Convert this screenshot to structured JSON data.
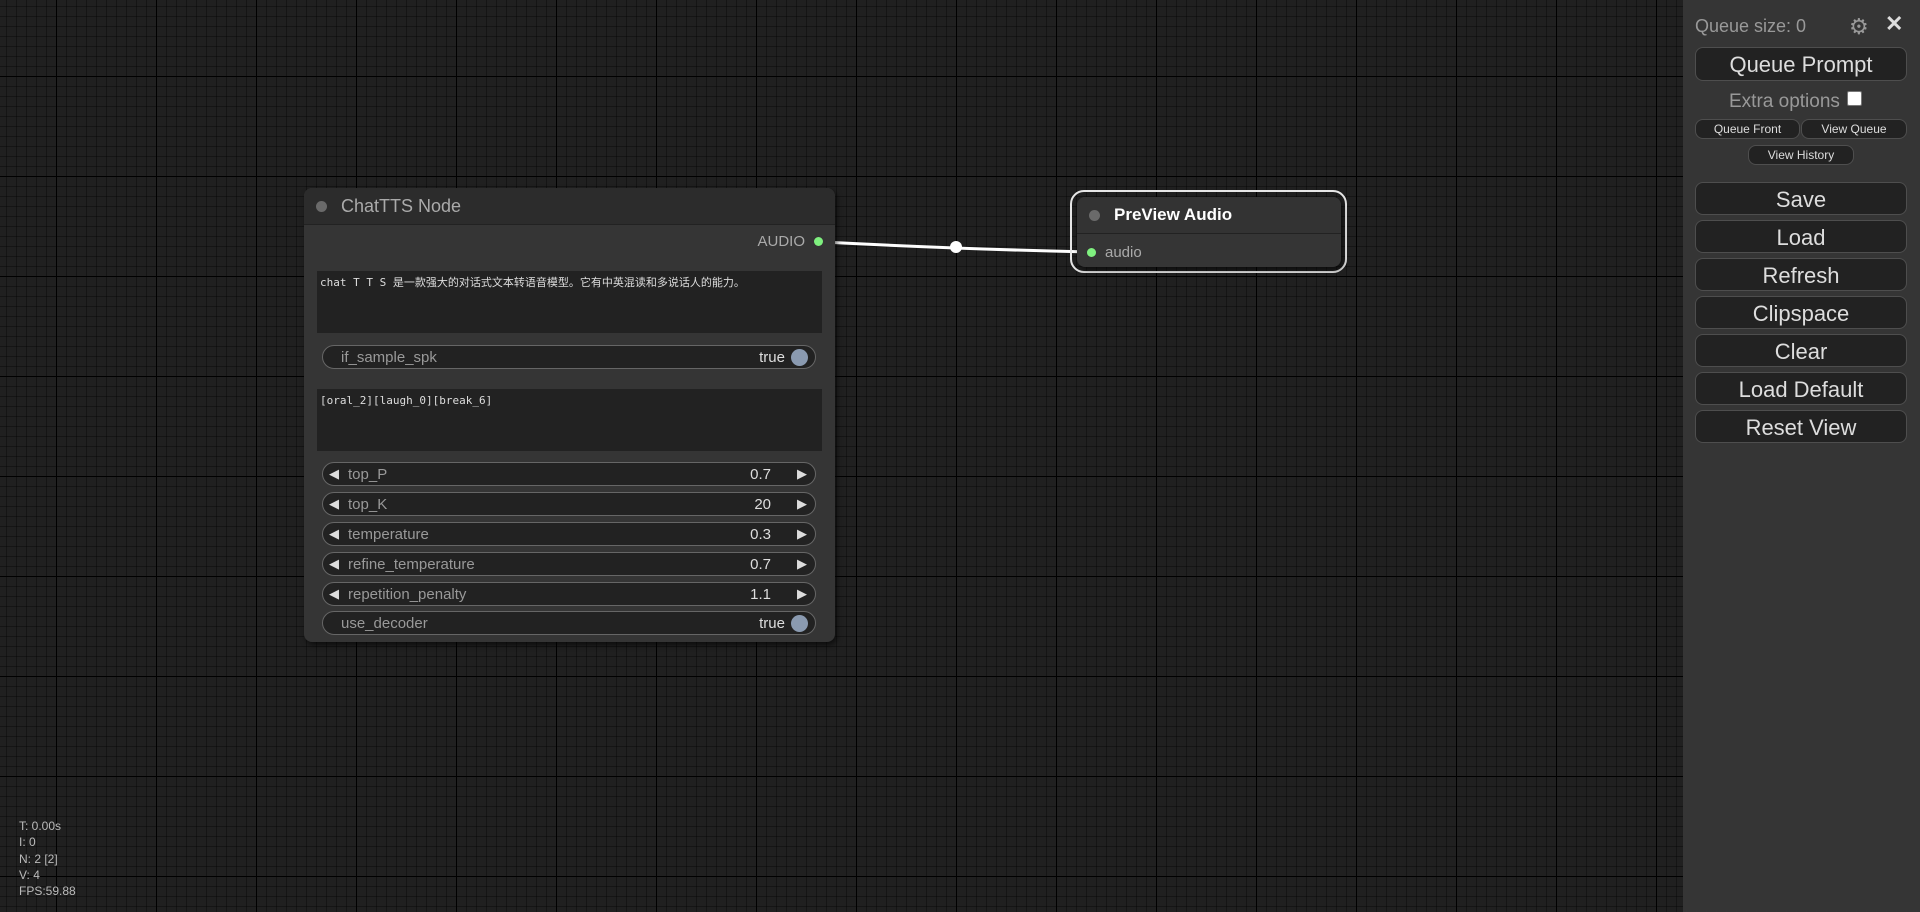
{
  "canvas": {
    "link_color": "#ffffff",
    "slot_color": "#7ff07f"
  },
  "chattts_node": {
    "title": "ChatTTS Node",
    "output_label": "AUDIO",
    "text": "chat T T S 是一款强大的对话式文本转语音模型。它有中英混读和多说话人的能力。",
    "if_sample_spk": {
      "name": "if_sample_spk",
      "value": "true"
    },
    "prompt_text": "[oral_2][laugh_0][break_6]",
    "params": [
      {
        "name": "top_P",
        "value": "0.7"
      },
      {
        "name": "top_K",
        "value": "20"
      },
      {
        "name": "temperature",
        "value": "0.3"
      },
      {
        "name": "refine_temperature",
        "value": "0.7"
      },
      {
        "name": "repetition_penalty",
        "value": "1.1"
      }
    ],
    "use_decoder": {
      "name": "use_decoder",
      "value": "true"
    }
  },
  "preview_node": {
    "title": "PreView Audio",
    "input_label": "audio"
  },
  "stats": {
    "t": "T: 0.00s",
    "i": "I: 0",
    "n": "N: 2 [2]",
    "v": "V: 4",
    "fps": "FPS:59.88"
  },
  "menu": {
    "queue_size": "Queue size: 0",
    "queue_prompt": "Queue Prompt",
    "extra_options": "Extra options",
    "queue_front": "Queue Front",
    "view_queue": "View Queue",
    "view_history": "View History",
    "save": "Save",
    "load": "Load",
    "refresh": "Refresh",
    "clipspace": "Clipspace",
    "clear": "Clear",
    "load_default": "Load Default",
    "reset_view": "Reset View"
  }
}
